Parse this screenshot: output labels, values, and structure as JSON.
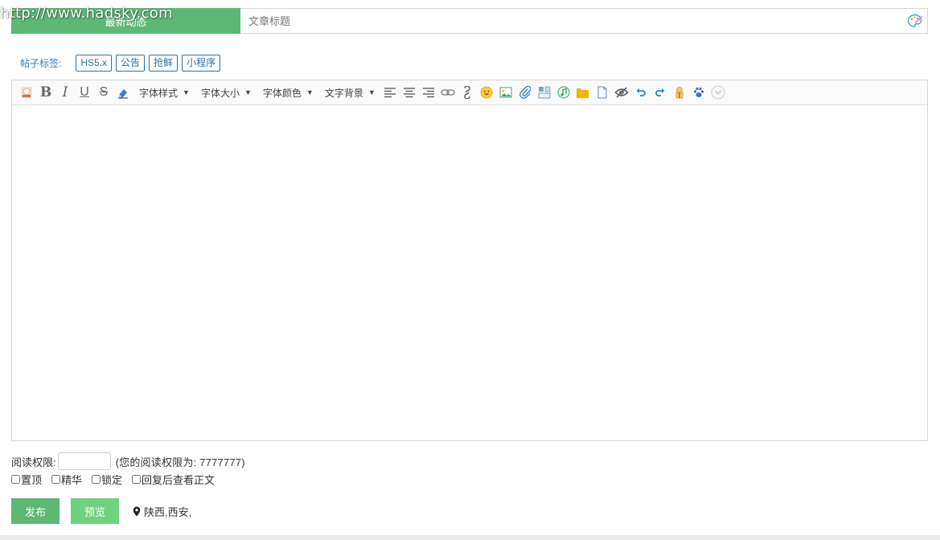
{
  "watermark": "http://www.hadsky.com",
  "title_bar": {
    "category": "最新动态",
    "title_placeholder": "文章标题"
  },
  "tags": {
    "label": "帖子标签:",
    "items": [
      "HS5.x",
      "公告",
      "抢鲜",
      "小程序"
    ]
  },
  "toolbar": {
    "dropdowns": [
      "字体样式",
      "字体大小",
      "字体颜色",
      "文字背景"
    ],
    "icons": [
      "face-icon",
      "bold-icon",
      "italic-icon",
      "underline-icon",
      "strikethrough-icon",
      "eraser-icon",
      "align-left-icon",
      "align-center-icon",
      "align-right-icon",
      "link-icon",
      "unlink-icon",
      "emoji-icon",
      "image-icon",
      "attachment-icon",
      "gallery-icon",
      "music-icon",
      "folder-icon",
      "file-icon",
      "hide-icon",
      "undo-icon",
      "redo-icon",
      "gift-icon",
      "paw-icon",
      "disabled-icon"
    ]
  },
  "permission": {
    "label": "阅读权限:",
    "value": "",
    "hint": "(您的阅读权限为: 7777777)"
  },
  "options": {
    "sticky": "置顶",
    "featured": "精华",
    "locked": "锁定",
    "reply_to_view": "回复后查看正文"
  },
  "actions": {
    "publish": "发布",
    "preview": "预览"
  },
  "location": "陕西,西安,",
  "colors": {
    "accent": "#5cb974",
    "preview": "#6fd27f",
    "tag": "#2a6fa8"
  }
}
